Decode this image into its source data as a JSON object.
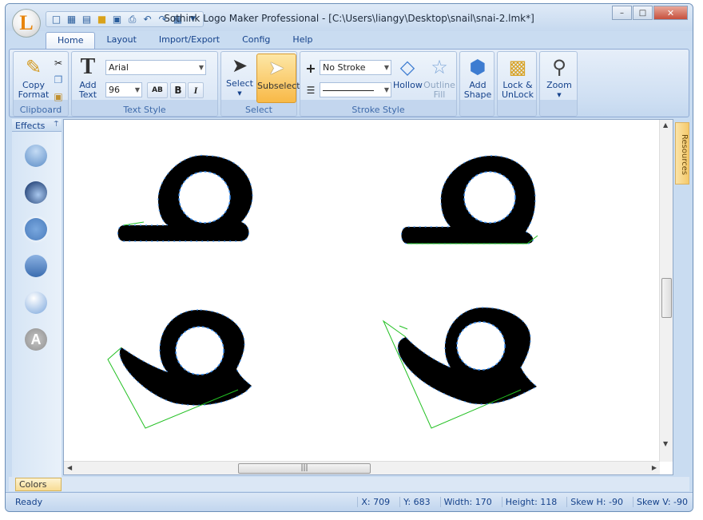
{
  "window": {
    "title": "Sothink Logo Maker Professional - [C:\\Users\\liangy\\Desktop\\snail\\snai-2.lmk*]",
    "minimize": "–",
    "maximize": "□",
    "close": "✕"
  },
  "tabs": [
    {
      "label": "Home"
    },
    {
      "label": "Layout"
    },
    {
      "label": "Import/Export"
    },
    {
      "label": "Config"
    },
    {
      "label": "Help"
    }
  ],
  "ribbon": {
    "clipboard": {
      "label": "Clipboard",
      "copy_format": "Copy\nFormat"
    },
    "text_style": {
      "label": "Text Style",
      "add_text": "Add\nText",
      "font": "Arial",
      "size": "96",
      "bold": "B",
      "italic": "I",
      "spacing": "AB"
    },
    "select": {
      "label": "Select",
      "select": "Select",
      "subselect": "Subselect"
    },
    "stroke_style": {
      "label": "Stroke Style",
      "stroke": "No Stroke",
      "hollow": "Hollow",
      "outline_fill": "Outline\nFill"
    },
    "add_shape": "Add\nShape",
    "lock": "Lock &\nUnLock",
    "zoom": "Zoom"
  },
  "effects": {
    "title": "Effects",
    "pin": "⍑"
  },
  "resources": "Resources",
  "colors": "Colors",
  "status": {
    "ready": "Ready",
    "x": "X: 709",
    "y": "Y: 683",
    "width": "Width: 170",
    "height": "Height: 118",
    "skew_h": "Skew H: -90",
    "skew_v": "Skew V: -90"
  },
  "accent": "#4a90e2",
  "anchor_color": "#3b8ef0",
  "path_color": "#22c022"
}
